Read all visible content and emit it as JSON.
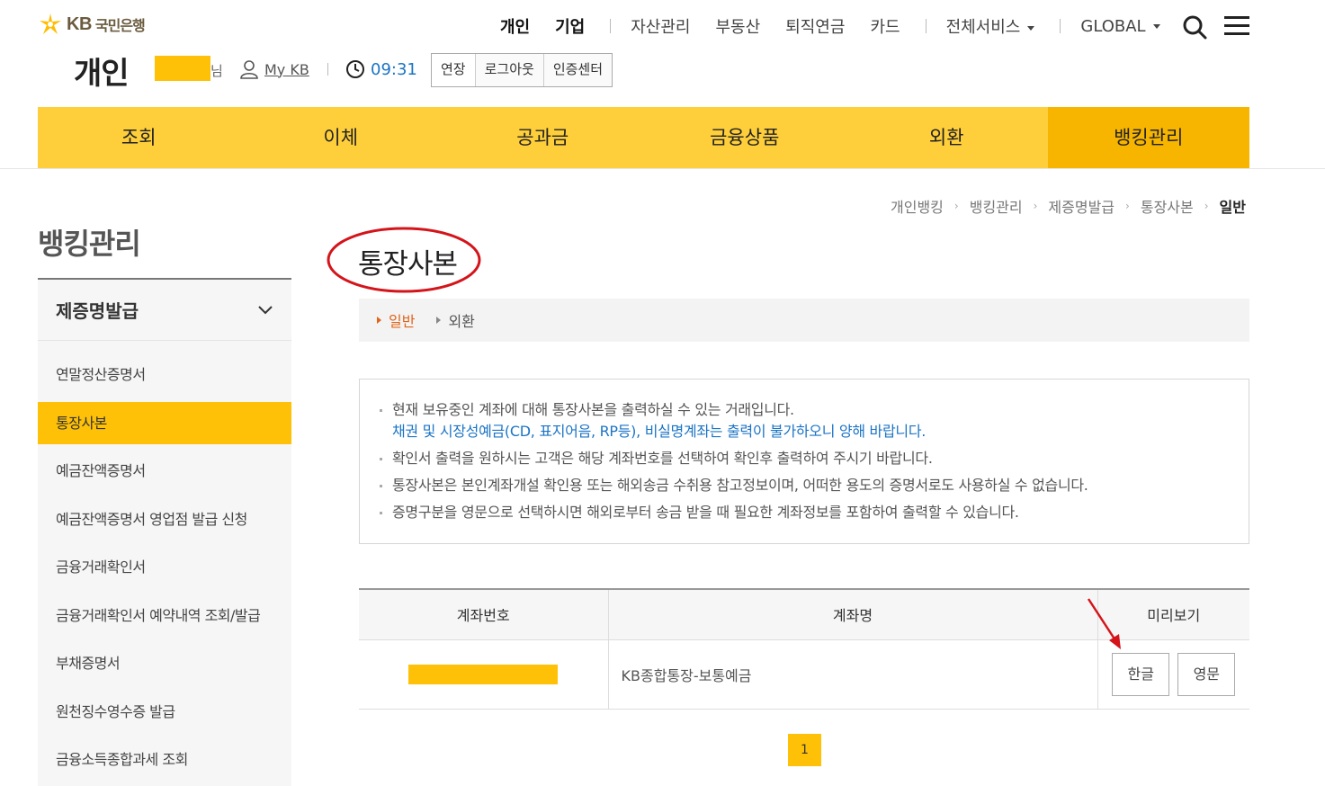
{
  "logo": {
    "kb": "KB",
    "bank": "국민은행"
  },
  "gnb": {
    "items": [
      "개인",
      "기업",
      "자산관리",
      "부동산",
      "퇴직연금",
      "카드",
      "전체서비스",
      "GLOBAL"
    ]
  },
  "user_bar": {
    "section_title": "개인",
    "name_suffix": "님",
    "mykb": "My KB",
    "timer": "09:31",
    "buttons": [
      "연장",
      "로그아웃",
      "인증센터"
    ]
  },
  "main_nav": {
    "items": [
      "조회",
      "이체",
      "공과금",
      "금융상품",
      "외환",
      "뱅킹관리"
    ],
    "active_index": 5
  },
  "sidebar": {
    "title": "뱅킹관리",
    "group": "제증명발급",
    "items": [
      "연말정산증명서",
      "통장사본",
      "예금잔액증명서",
      "예금잔액증명서 영업점 발급 신청",
      "금융거래확인서",
      "금융거래확인서 예약내역 조회/발급",
      "부채증명서",
      "원천징수영수증 발급",
      "금융소득종합과세 조회"
    ],
    "active_index": 1
  },
  "breadcrumb": [
    "개인뱅킹",
    "뱅킹관리",
    "제증명발급",
    "통장사본",
    "일반"
  ],
  "page_title": "통장사본",
  "tabs": [
    "일반",
    "외환"
  ],
  "notice": {
    "line1": "현재 보유중인 계좌에 대해 통장사본을 출력하실 수 있는 거래입니다.",
    "line1_blue": "채권 및 시장성예금(CD, 표지어음, RP등), 비실명계좌는 출력이 불가하오니 양해 바랍니다.",
    "line2": "확인서 출력을 원하시는 고객은 해당 계좌번호를 선택하여 확인후 출력하여 주시기 바랍니다.",
    "line3": "통장사본은 본인계좌개설 확인용 또는 해외송금 수취용 참고정보이며, 어떠한 용도의 증명서로도 사용하실 수 없습니다.",
    "line4": "증명구분을 영문으로 선택하시면 해외로부터 송금 받을 때 필요한 계좌정보를 포함하여 출력할 수 있습니다."
  },
  "table": {
    "headers": [
      "계좌번호",
      "계좌명",
      "미리보기"
    ],
    "rows": [
      {
        "account_name": "KB종합통장-보통예금",
        "btn_korean": "한글",
        "btn_english": "영문"
      }
    ]
  },
  "pagination": {
    "current": "1"
  },
  "colors": {
    "brand_yellow": "#ffcf3b",
    "active_yellow": "#f8b500",
    "highlight": "#ffc107",
    "link_blue": "#1b74c5",
    "tab_orange": "#e0641a",
    "annotation_red": "#d4141a"
  }
}
